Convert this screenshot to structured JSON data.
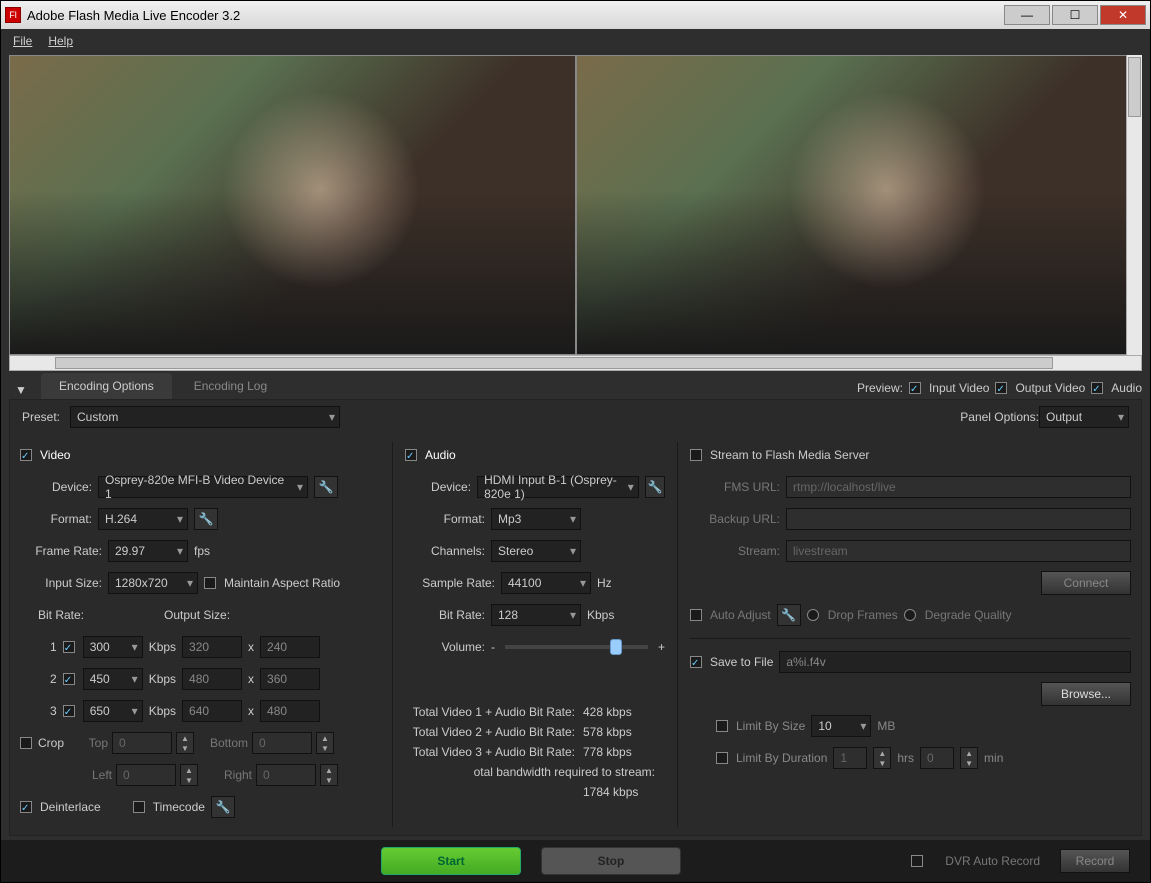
{
  "window": {
    "title": "Adobe Flash Media Live Encoder 3.2"
  },
  "menu": {
    "file": "File",
    "help": "Help"
  },
  "tabs": {
    "options": "Encoding Options",
    "log": "Encoding Log"
  },
  "preview_label": "Preview:",
  "preview_checks": {
    "input": "Input Video",
    "output": "Output Video",
    "audio": "Audio"
  },
  "preset_label": "Preset:",
  "preset_value": "Custom",
  "panel_opts_label": "Panel Options:",
  "panel_opts_value": "Output",
  "video": {
    "header": "Video",
    "device_label": "Device:",
    "device": "Osprey-820e MFI-B Video Device 1",
    "format_label": "Format:",
    "format": "H.264",
    "frame_label": "Frame Rate:",
    "frame": "29.97",
    "fps": "fps",
    "input_size_label": "Input Size:",
    "input_size": "1280x720",
    "aspect": "Maintain Aspect Ratio",
    "bitrate_label": "Bit Rate:",
    "outsize_label": "Output Size:",
    "streams": [
      {
        "n": "1",
        "rate": "300",
        "w": "320",
        "h": "240"
      },
      {
        "n": "2",
        "rate": "450",
        "w": "480",
        "h": "360"
      },
      {
        "n": "3",
        "rate": "650",
        "w": "640",
        "h": "480"
      }
    ],
    "kbps": "Kbps",
    "x": "x",
    "crop": "Crop",
    "top": "Top",
    "left": "Left",
    "bottom": "Bottom",
    "right": "Right",
    "crop_val": "0",
    "deinterlace": "Deinterlace",
    "timecode": "Timecode"
  },
  "audio": {
    "header": "Audio",
    "device_label": "Device:",
    "device": "HDMI Input B-1 (Osprey-820e 1)",
    "format_label": "Format:",
    "format": "Mp3",
    "channels_label": "Channels:",
    "channels": "Stereo",
    "sample_label": "Sample Rate:",
    "sample": "44100",
    "hz": "Hz",
    "bitrate_label": "Bit Rate:",
    "bitrate": "128",
    "kbps": "Kbps",
    "volume": "Volume:",
    "minus": "-",
    "plus": "+"
  },
  "totals": {
    "l1": "Total Video 1 + Audio Bit Rate:",
    "v1": "428 kbps",
    "l2": "Total Video 2 + Audio Bit Rate:",
    "v2": "578 kbps",
    "l3": "Total Video 3 + Audio Bit Rate:",
    "v3": "778 kbps",
    "l4": "otal bandwidth required to stream:",
    "v4": "1784 kbps"
  },
  "output": {
    "stream_fms": "Stream to Flash Media Server",
    "fms_url_l": "FMS URL:",
    "fms_url": "rtmp://localhost/live",
    "backup_l": "Backup URL:",
    "backup": "",
    "stream_l": "Stream:",
    "stream": "livestream",
    "connect": "Connect",
    "auto_adjust": "Auto Adjust",
    "drop": "Drop Frames",
    "degrade": "Degrade Quality",
    "save_file": "Save to File",
    "file": "a%i.f4v",
    "browse": "Browse...",
    "limit_size": "Limit By Size",
    "size_val": "10",
    "mb": "MB",
    "limit_dur": "Limit By Duration",
    "dur_h": "1",
    "hrs": "hrs",
    "dur_m": "0",
    "min": "min"
  },
  "footer": {
    "start": "Start",
    "stop": "Stop",
    "dvr": "DVR Auto Record",
    "record": "Record"
  }
}
